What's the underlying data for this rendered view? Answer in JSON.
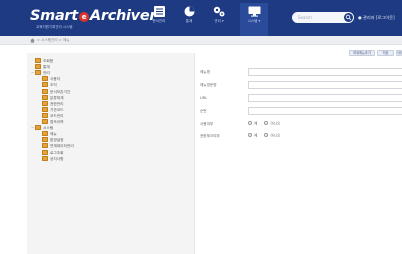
{
  "header": {
    "brand_name_left": "Smart",
    "brand_logo_letter": "e",
    "brand_name_right": "Archiver",
    "brand_subtitle": "교육지원기록관리 시스템",
    "nav": [
      {
        "label": "문서관리",
        "icon": "list-icon"
      },
      {
        "label": "통계",
        "icon": "pie-chart-icon"
      },
      {
        "label": "관리 ▾",
        "icon": "gears-icon"
      },
      {
        "label": "시스템 ▾",
        "icon": "monitor-icon"
      }
    ],
    "search_placeholder": "Search",
    "user_name": "관리자",
    "user_action": "[로그아웃]"
  },
  "breadcrumb": {
    "path": "> 시스템관리 > 메뉴"
  },
  "tree": [
    {
      "label": "조회함",
      "level": 0,
      "toggle": ""
    },
    {
      "label": "통계",
      "level": 0,
      "toggle": ""
    },
    {
      "label": "관리",
      "level": 0,
      "toggle": "−"
    },
    {
      "label": "사용자",
      "level": 1,
      "toggle": ""
    },
    {
      "label": "조직",
      "level": 1,
      "toggle": ""
    },
    {
      "label": "문서보존기간",
      "level": 1,
      "toggle": ""
    },
    {
      "label": "분류체계",
      "level": 1,
      "toggle": ""
    },
    {
      "label": "권한관리",
      "level": 1,
      "toggle": ""
    },
    {
      "label": "기관코드",
      "level": 1,
      "toggle": ""
    },
    {
      "label": "코드관리",
      "level": 1,
      "toggle": ""
    },
    {
      "label": "접속이력",
      "level": 1,
      "toggle": ""
    },
    {
      "label": "시스템",
      "level": 0,
      "toggle": "−"
    },
    {
      "label": "메뉴",
      "level": 1,
      "toggle": ""
    },
    {
      "label": "환경설정",
      "level": 1,
      "toggle": ""
    },
    {
      "label": "연계데이터관리",
      "level": 1,
      "toggle": ""
    },
    {
      "label": "로그조회",
      "level": 1,
      "toggle": ""
    },
    {
      "label": "공지사항",
      "level": 1,
      "toggle": ""
    }
  ],
  "toolbar": {
    "buttons": [
      "하위메뉴추가",
      "저장",
      "삭제"
    ]
  },
  "form": {
    "fields": [
      {
        "label": "메뉴명",
        "type": "text",
        "value": ""
      },
      {
        "label": "메뉴영문명",
        "type": "text",
        "value": ""
      },
      {
        "label": "URL",
        "type": "text",
        "value": ""
      },
      {
        "label": "순번",
        "type": "text",
        "value": ""
      },
      {
        "label": "사용여부",
        "type": "radio",
        "options": [
          "예",
          "아니오"
        ]
      },
      {
        "label": "권한체크여부",
        "type": "radio",
        "options": [
          "예",
          "아니오"
        ]
      }
    ]
  },
  "colors": {
    "header_bg": "#1d3a82",
    "accent_red": "#d9342b",
    "folder": "#e3a33c",
    "panel_bg": "#f4f4f4"
  }
}
